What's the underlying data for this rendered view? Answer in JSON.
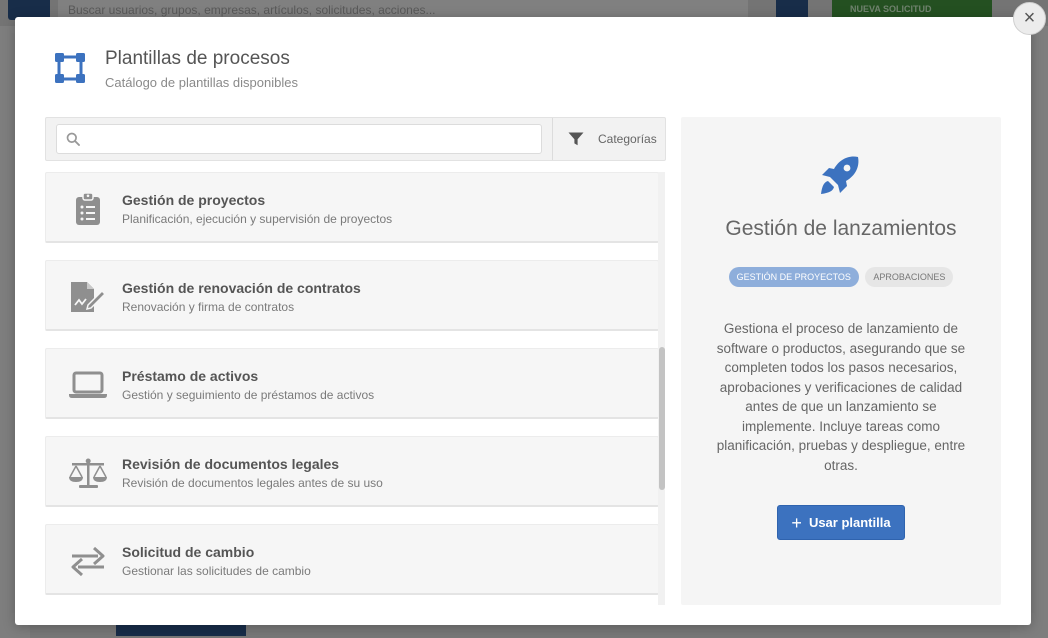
{
  "background": {
    "search_placeholder": "Buscar usuarios, grupos, empresas, artículos, solicitudes, acciones...",
    "new_request_label": "NUEVA SOLICITUD"
  },
  "modal": {
    "title": "Plantillas de procesos",
    "subtitle": "Catálogo de plantillas disponibles",
    "close_label": "×",
    "search": {
      "placeholder": "",
      "value": ""
    },
    "filter_label": "Categorías",
    "templates": [
      {
        "name": "Gestión de proyectos",
        "description": "Planificación, ejecución y supervisión de proyectos",
        "icon": "clipboard-list-icon"
      },
      {
        "name": "Gestión de renovación de contratos",
        "description": "Renovación y firma de contratos",
        "icon": "file-signature-icon"
      },
      {
        "name": "Préstamo de activos",
        "description": "Gestión y seguimiento de préstamos de activos",
        "icon": "laptop-icon"
      },
      {
        "name": "Revisión de documentos legales",
        "description": "Revisión de documentos legales antes de su uso",
        "icon": "balance-scale-icon"
      },
      {
        "name": "Solicitud de cambio",
        "description": "Gestionar las solicitudes de cambio",
        "icon": "exchange-arrows-icon"
      }
    ],
    "detail": {
      "icon": "rocket-icon",
      "title": "Gestión de lanzamientos",
      "tags": [
        "GESTIÓN DE PROYECTOS",
        "APROBACIONES"
      ],
      "description": "Gestiona el proceso de lanzamiento de software o productos, asegurando que se completen todos los pasos necesarios, aprobaciones y verificaciones de calidad antes de que un lanzamiento se implemente. Incluye tareas como planificación, pruebas y despliegue, entre otras.",
      "use_button_label": "Usar plantilla"
    }
  },
  "colors": {
    "accent": "#3c72bf",
    "tag_primary": "#8eaedb",
    "icon_gray": "#8f8f8f"
  }
}
